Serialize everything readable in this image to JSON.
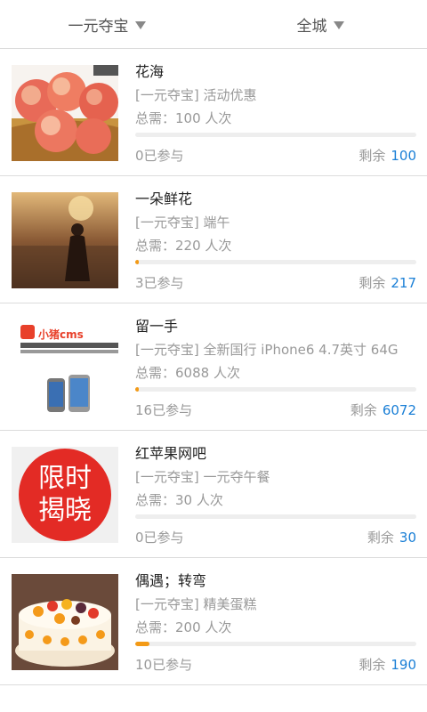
{
  "filters": [
    {
      "label": "一元夺宝",
      "icon": "triangle-down-icon"
    },
    {
      "label": "全城",
      "icon": "triangle-down-icon"
    }
  ],
  "colors": {
    "progress": "#f39a16",
    "remain": "#1a7fd6",
    "text": "#222222",
    "muted": "#999999"
  },
  "items": [
    {
      "name": "花海",
      "desc": "[一元夺宝] 活动优惠",
      "total": "总需：100 人次",
      "joined": "0已参与",
      "remain_label": "剩余",
      "remain": "100",
      "progress": 0.0,
      "thumb_text": ""
    },
    {
      "name": "一朵鲜花",
      "desc": "[一元夺宝] 端午",
      "total": "总需：220 人次",
      "joined": "3已参与",
      "remain_label": "剩余",
      "remain": "217",
      "progress": 0.0136,
      "thumb_text": ""
    },
    {
      "name": "留一手",
      "desc": "[一元夺宝] 全新国行 iPhone6 4.7英寸 64G",
      "total": "总需：6088 人次",
      "joined": "16已参与",
      "remain_label": "剩余",
      "remain": "6072",
      "progress": 0.0026,
      "thumb_text": "小猪cms"
    },
    {
      "name": "红苹果网吧",
      "desc": "[一元夺宝] 一元夺午餐",
      "total": "总需：30 人次",
      "joined": "0已参与",
      "remain_label": "剩余",
      "remain": "30",
      "progress": 0.0,
      "thumb_text": "限时揭晓"
    },
    {
      "name": "偶遇；转弯",
      "desc": "[一元夺宝] 精美蛋糕",
      "total": "总需：200 人次",
      "joined": "10已参与",
      "remain_label": "剩余",
      "remain": "190",
      "progress": 0.05,
      "thumb_text": ""
    }
  ]
}
